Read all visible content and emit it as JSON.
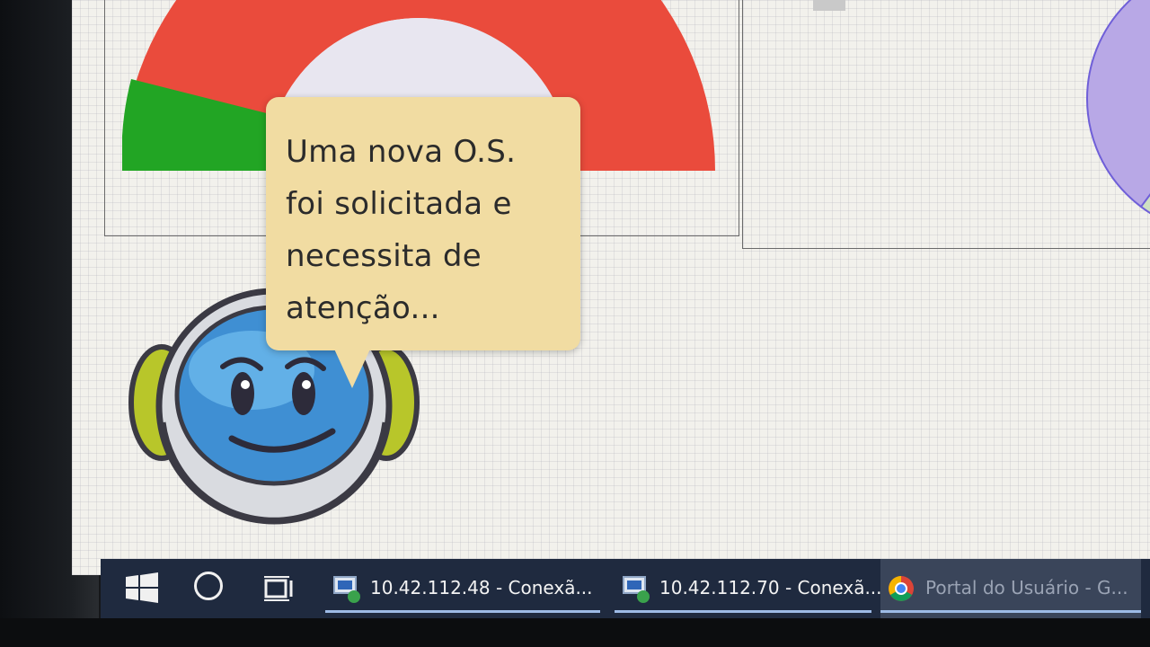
{
  "notification": {
    "line1": "Uma nova O.S.",
    "line2": "foi solicitada e",
    "line3": "necessita de",
    "line4": "atenção..."
  },
  "taskbar": {
    "apps": [
      {
        "label": "10.42.112.48 - Conexã...",
        "icon": "remote-desktop-icon"
      },
      {
        "label": "10.42.112.70 - Conexã...",
        "icon": "remote-desktop-icon"
      },
      {
        "label": "Portal do Usuário - G...",
        "icon": "chrome-icon"
      }
    ]
  },
  "colors": {
    "gauge_red": "#ea4b3c",
    "gauge_green": "#22a524",
    "bubble": "#f1dca2",
    "taskbar": "#1f2a3f",
    "pie_purple": "#b8a8e6"
  }
}
